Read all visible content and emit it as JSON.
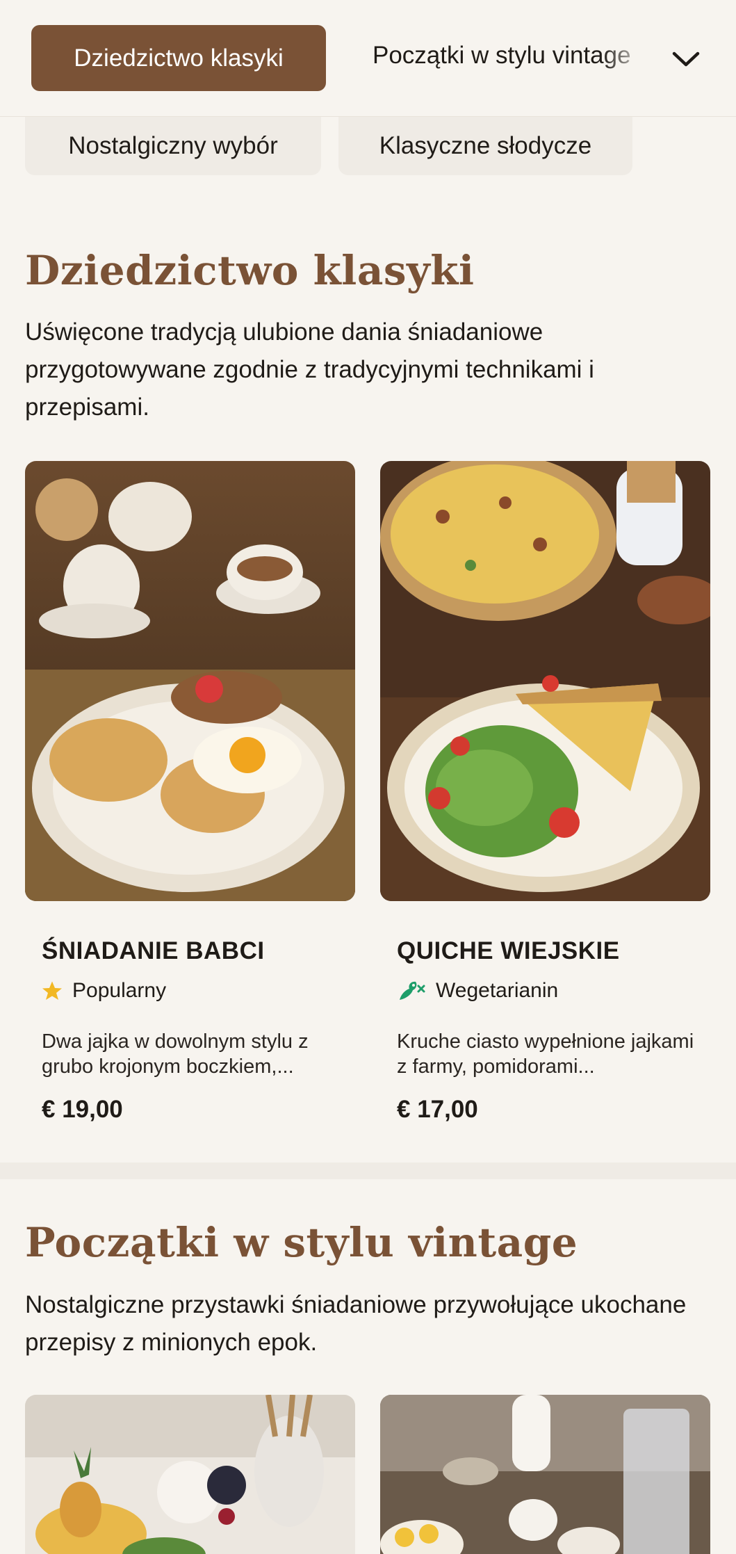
{
  "nav": {
    "active_category": "Dziedzictwo klasyki",
    "next_category": "Początki w stylu vintage",
    "pills": [
      "Nostalgiczny wybór",
      "Klasyczne słodycze"
    ]
  },
  "sections": [
    {
      "title": "Dziedzictwo klasyki",
      "description": "Uświęcone tradycją ulubione dania śniadaniowe przygotowywane zgodnie z tradycyjnymi technikami i przepisami.",
      "items": [
        {
          "name": "ŚNIADANIE BABCI",
          "tag": "Popularny",
          "tag_icon": "star-icon",
          "description": "Dwa jajka w dowolnym stylu z grubo krojonym boczkiem,...",
          "price": "€ 19,00"
        },
        {
          "name": "QUICHE WIEJSKIE",
          "tag": "Wegetarianin",
          "tag_icon": "vegetarian-icon",
          "description": "Kruche ciasto wypełnione jajkami z farmy, pomidorami...",
          "price": "€ 17,00"
        }
      ]
    },
    {
      "title": "Początki w stylu vintage",
      "description": "Nostalgiczne przystawki śniadaniowe przywołujące ukochane przepisy z minionych epok."
    }
  ],
  "colors": {
    "accent": "#7a5236",
    "background": "#f7f4ef",
    "star": "#f2b824",
    "veg": "#1e9e6a"
  }
}
